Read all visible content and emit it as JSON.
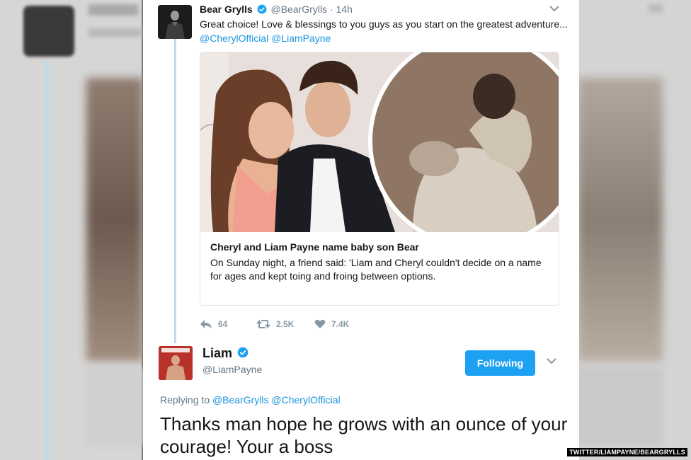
{
  "tweet1": {
    "name": "Bear Grylls",
    "handle": "@BearGrylls",
    "separator": "·",
    "time": "14h",
    "text": "Great choice! Love & blessings to you guys as you start on the greatest adventure... ",
    "mentions": [
      "@CherylOfficial",
      "@LiamPayne"
    ],
    "link_card": {
      "title": "Cheryl and Liam Payne name baby son Bear",
      "description": "On Sunday night, a friend said: 'Liam and Cheryl couldn't decide on a name for ages and kept toing and froing between options."
    },
    "stats": {
      "replies": "64",
      "retweets": "2.5K",
      "likes": "7.4K"
    }
  },
  "tweet2": {
    "name": "Liam",
    "handle": "@LiamPayne",
    "follow_label": "Following",
    "replying_prefix": "Replying to",
    "replying_to": [
      "@BearGrylls",
      "@CherylOfficial"
    ],
    "text": "Thanks man hope he grows with an ounce of your courage! Your a boss"
  },
  "credit": "TWITTER/LIAMPAYNE/BEARGRYLLS",
  "icons": [
    "verified-icon",
    "chevron-down-icon",
    "reply-icon",
    "retweet-icon",
    "heart-icon"
  ],
  "colors": {
    "accent": "#1da1f2",
    "link": "#1b95e0",
    "muted": "#657786",
    "thread_line": "#c6d8ea"
  }
}
